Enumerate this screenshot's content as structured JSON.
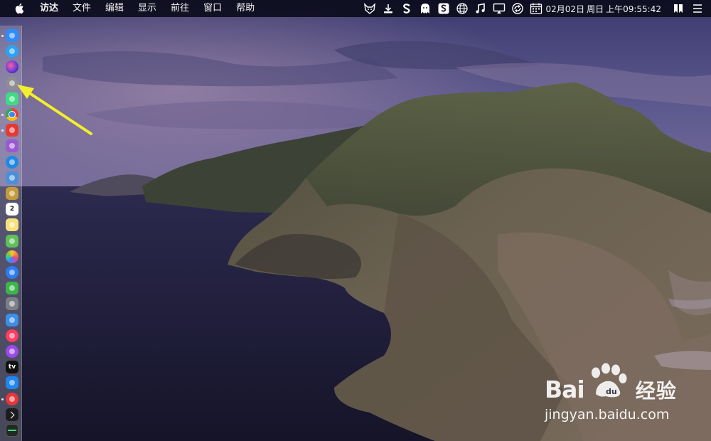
{
  "menubar": {
    "app_name": "访达",
    "menus": [
      "文件",
      "编辑",
      "显示",
      "前往",
      "窗口",
      "帮助"
    ],
    "status_icons": [
      "fox-icon",
      "download-icon",
      "s-app-icon",
      "ghost-icon",
      "sogou-icon",
      "globe-icon",
      "music-note-icon",
      "display-icon",
      "sync-icon"
    ],
    "clock": {
      "date": "02月02日",
      "weekday": "周日",
      "time": "上午09:55:42"
    }
  },
  "dock": {
    "icons": [
      {
        "name": "finder-icon",
        "color": "#2f8cff",
        "running": true
      },
      {
        "name": "app-store-icon",
        "color": "#2aa3f5",
        "running": false
      },
      {
        "name": "siri-icon",
        "color": "#6a3cd8",
        "running": false
      },
      {
        "name": "launchpad-icon",
        "color": "#8e8e93",
        "running": false
      },
      {
        "name": "android-icon",
        "color": "#3ddc84",
        "running": false
      },
      {
        "name": "chrome-icon",
        "color": "#e94235",
        "running": true
      },
      {
        "name": "red-app-icon",
        "color": "#e53935",
        "running": true
      },
      {
        "name": "purple-app-icon",
        "color": "#9b59d0",
        "running": false
      },
      {
        "name": "safari-icon",
        "color": "#1e88e5",
        "running": false
      },
      {
        "name": "preview-icon",
        "color": "#4a90d9",
        "running": false
      },
      {
        "name": "notes-app-icon",
        "color": "#c49a3a",
        "running": false
      },
      {
        "name": "calendar-icon",
        "color": "#ffffff",
        "running": false,
        "text": "2"
      },
      {
        "name": "notes-icon",
        "color": "#f7e17a",
        "running": false
      },
      {
        "name": "maps-icon",
        "color": "#5fbf5a",
        "running": false
      },
      {
        "name": "photos-icon",
        "color": "#f28a3a",
        "running": false
      },
      {
        "name": "messages-icon",
        "color": "#2a7cf6",
        "running": false
      },
      {
        "name": "facetime-icon",
        "color": "#3cb54a",
        "running": false
      },
      {
        "name": "system-preferences-icon",
        "color": "#7d7f86",
        "running": false
      },
      {
        "name": "keynote-icon",
        "color": "#3b8fe8",
        "running": false
      },
      {
        "name": "music-icon",
        "color": "#fb3e62",
        "running": false
      },
      {
        "name": "podcasts-icon",
        "color": "#9a4ae8",
        "running": false
      },
      {
        "name": "tv-icon",
        "color": "#111111",
        "running": false,
        "text": "tv"
      },
      {
        "name": "app-store-blue-icon",
        "color": "#1e86f0",
        "running": false
      },
      {
        "name": "vivaldi-icon",
        "color": "#e5383b",
        "running": true
      },
      {
        "name": "terminal-icon",
        "color": "#1c1c1c",
        "running": false
      },
      {
        "name": "activity-monitor-icon",
        "color": "#222a22",
        "running": false
      }
    ]
  },
  "watermark": {
    "brand_latin": "Bai",
    "brand_latin_2": "du",
    "brand_cn": "经验",
    "url": "jingyan.baidu.com"
  },
  "colors": {
    "arrow": "#f3ef2a",
    "menubar": "#0c0c1c"
  }
}
